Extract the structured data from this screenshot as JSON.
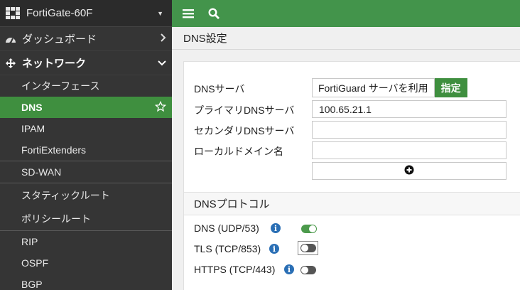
{
  "app": {
    "device_name": "FortiGate-60F"
  },
  "sidebar": {
    "dashboard_label": "ダッシュボード",
    "network_label": "ネットワーク",
    "items": [
      {
        "label": "インターフェース"
      },
      {
        "label": "DNS"
      },
      {
        "label": "IPAM"
      },
      {
        "label": "FortiExtenders"
      },
      {
        "label": "SD-WAN"
      },
      {
        "label": "スタティックルート"
      },
      {
        "label": "ポリシールート"
      },
      {
        "label": "RIP"
      },
      {
        "label": "OSPF"
      },
      {
        "label": "BGP"
      }
    ]
  },
  "page": {
    "title": "DNS設定"
  },
  "form": {
    "dns_server_label": "DNSサーバ",
    "dns_server_options": [
      "FortiGuard サーバを利用",
      "指定"
    ],
    "dns_server_selected": "指定",
    "primary_label": "プライマリDNSサーバ",
    "primary_value": "100.65.21.1",
    "secondary_label": "セカンダリDNSサーバ",
    "secondary_value": "",
    "local_domain_label": "ローカルドメイン名",
    "local_domain_value": ""
  },
  "protocol": {
    "section_title": "DNSプロトコル",
    "items": [
      {
        "label": "DNS (UDP/53)",
        "enabled": true
      },
      {
        "label": "TLS (TCP/853)",
        "enabled": false
      },
      {
        "label": "HTTPS (TCP/443)",
        "enabled": false
      }
    ]
  },
  "colors": {
    "accent": "#43944b",
    "sidebar_bg": "#353535",
    "info": "#2a6fb5"
  }
}
